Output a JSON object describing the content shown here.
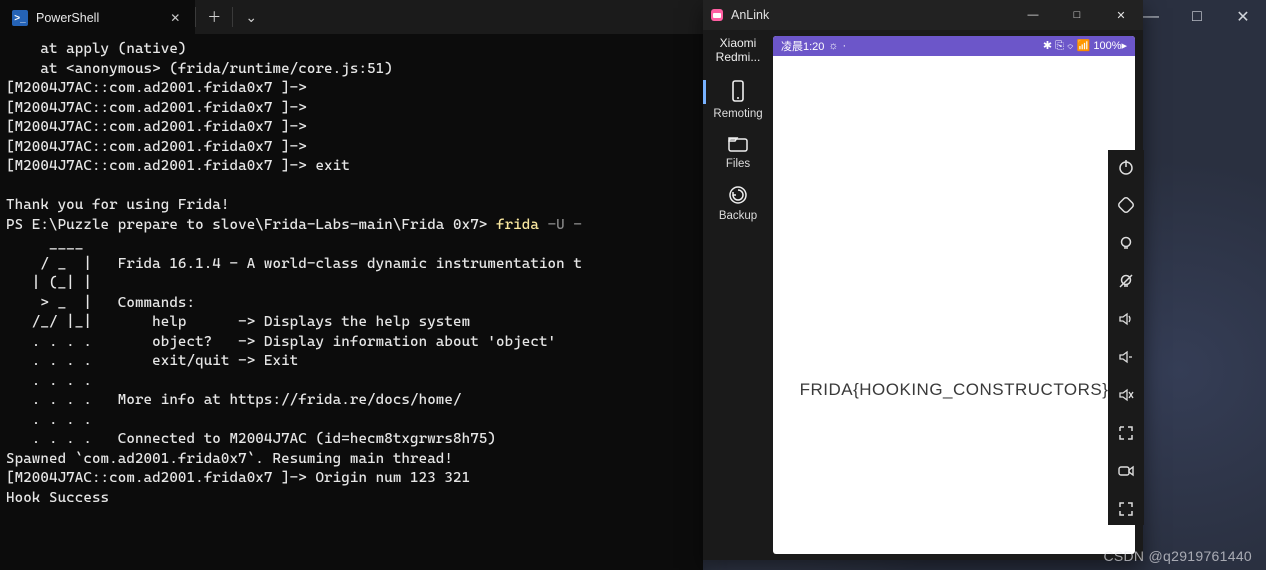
{
  "host": {
    "controls": {
      "min": "—",
      "max": "□",
      "close": "✕"
    }
  },
  "ps": {
    "tab_label": "PowerShell",
    "terminal": {
      "l1": "    at apply (native)",
      "l2": "    at <anonymous> (frida/runtime/core.js:51)",
      "l3": "[M2004J7AC::com.ad2001.frida0x7 ]->",
      "l4": "[M2004J7AC::com.ad2001.frida0x7 ]->",
      "l5": "[M2004J7AC::com.ad2001.frida0x7 ]->",
      "l6": "[M2004J7AC::com.ad2001.frida0x7 ]->",
      "l7": "[M2004J7AC::com.ad2001.frida0x7 ]-> exit",
      "l8": "",
      "l9": "Thank you for using Frida!",
      "l10a": "PS E:\\Puzzle prepare to slove\\Frida-Labs-main\\Frida 0x7> ",
      "l10b": "frida ",
      "l10c": "-U -",
      "l11": "     ____",
      "l12": "    / _  |   Frida 16.1.4 - A world-class dynamic instrumentation t",
      "l13": "   | (_| |",
      "l14": "    > _  |   Commands:",
      "l15": "   /_/ |_|       help      -> Displays the help system",
      "l16": "   . . . .       object?   -> Display information about 'object'",
      "l17": "   . . . .       exit/quit -> Exit",
      "l18": "   . . . .",
      "l19": "   . . . .   More info at https://frida.re/docs/home/",
      "l20": "   . . . .",
      "l21": "   . . . .   Connected to M2004J7AC (id=hecm8txgrwrs8h75)",
      "l22": "Spawned `com.ad2001.frida0x7`. Resuming main thread!",
      "l23": "[M2004J7AC::com.ad2001.frida0x7 ]-> Origin num 123 321",
      "l24": "Hook Success"
    }
  },
  "anlink": {
    "title": "AnLink",
    "ctrls": {
      "min": "—",
      "max": "□",
      "close": "✕"
    },
    "device_line1": "Xiaomi",
    "device_line2": "Redmi...",
    "side": {
      "remoting": "Remoting",
      "files": "Files",
      "backup": "Backup"
    },
    "status": {
      "time": "凌晨1:20",
      "wx": "☼",
      "right": "✱ ⎘ ⌔ 📶 100%▸"
    },
    "flag": "FRIDA{HOOKING_CONSTRUCTORS}"
  },
  "watermark": "CSDN @q2919761440"
}
